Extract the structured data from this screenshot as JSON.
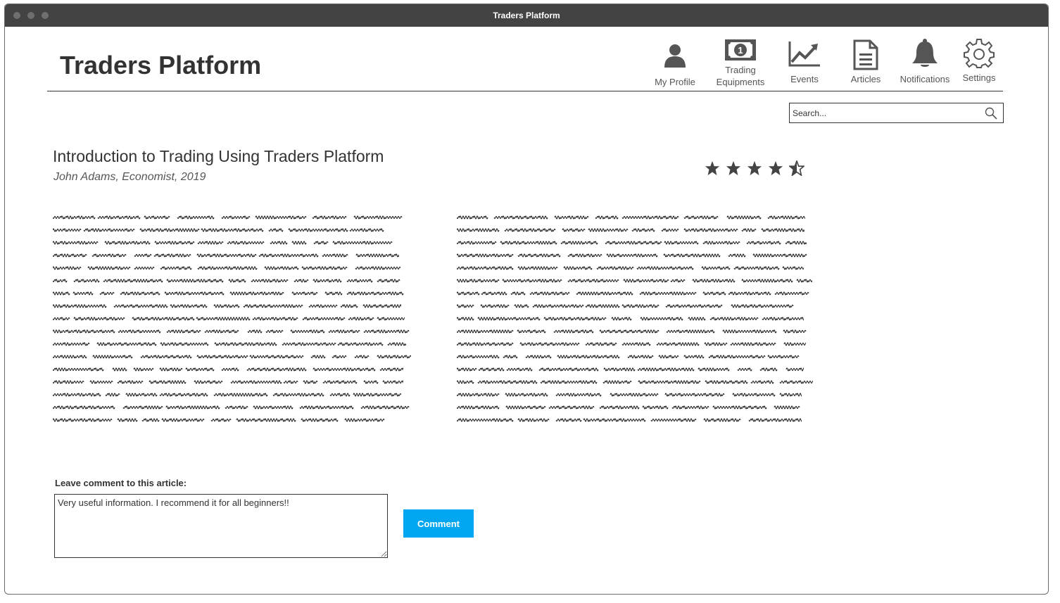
{
  "window": {
    "title": "Traders Platform"
  },
  "header": {
    "app_title": "Traders Platform",
    "nav": [
      {
        "label": "My Profile",
        "icon": "user-icon"
      },
      {
        "label": "Trading Equipments",
        "icon": "money-icon"
      },
      {
        "label": "Events",
        "icon": "line-chart-icon"
      },
      {
        "label": "Articles",
        "icon": "document-icon"
      },
      {
        "label": "Notifications",
        "icon": "bell-icon"
      },
      {
        "label": "Settings",
        "icon": "gear-icon"
      }
    ]
  },
  "search": {
    "placeholder": "Search..."
  },
  "article": {
    "title": "Introduction to Trading Using Traders Platform",
    "meta": "John Adams, Economist, 2019",
    "rating": 4.5,
    "rating_max": 5
  },
  "comment": {
    "label": "Leave comment to this article:",
    "value": "Very useful information. I recommend it for all beginners!!",
    "button_label": "Comment"
  },
  "colors": {
    "accent": "#00a7f0",
    "titlebar": "#434343",
    "icon": "#555555"
  }
}
